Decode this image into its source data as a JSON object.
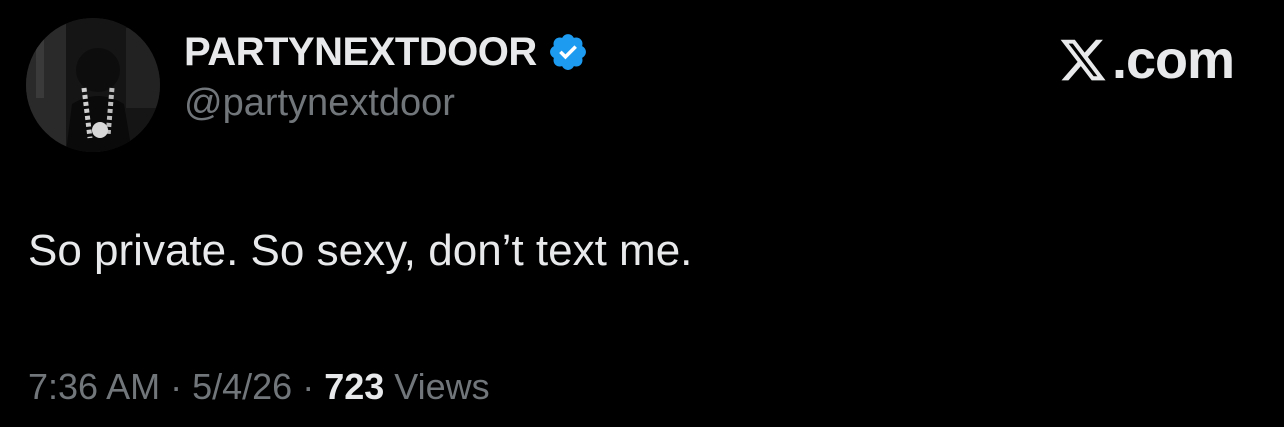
{
  "tweet": {
    "author": {
      "display_name": "PARTYNEXTDOOR",
      "handle": "@partynextdoor",
      "verified": true,
      "verified_color": "#1d9bf0"
    },
    "site": {
      "logo_icon": "x-logo-icon",
      "domain": ".com"
    },
    "text": "So private. So sexy, don’t text me.",
    "meta": {
      "time": "7:36 AM",
      "date": "5/4/26",
      "separator": "·",
      "views_count": "723",
      "views_label": "Views"
    }
  },
  "colors": {
    "background": "#000000",
    "primary_text": "#e7e9ea",
    "secondary_text": "#71767b",
    "accent": "#1d9bf0"
  }
}
